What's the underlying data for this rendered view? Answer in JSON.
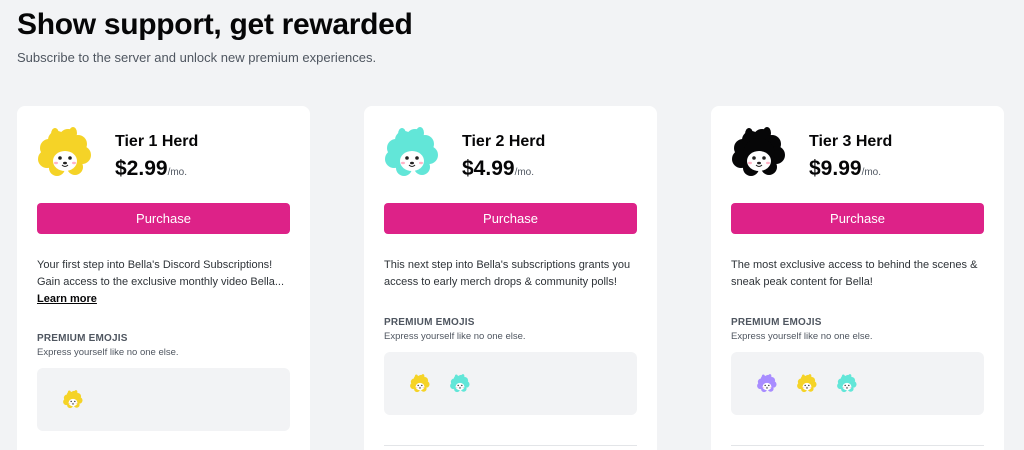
{
  "header": {
    "title": "Show support, get rewarded",
    "subtitle": "Subscribe to the server and unlock new premium experiences."
  },
  "tiers": [
    {
      "name": "Tier 1 Herd",
      "price": "$2.99",
      "period": "/mo.",
      "icon": "yellow-alpaca-icon",
      "purchase_label": "Purchase",
      "description": "Your first step into Bella's Discord Subscriptions! Gain access to the exclusive monthly video Bella...",
      "learn_more": "Learn more",
      "emoji_heading": "PREMIUM EMOJIS",
      "emoji_sub": "Express yourself like no one else.",
      "emojis": [
        "yellow-alpaca-emoji"
      ]
    },
    {
      "name": "Tier 2 Herd",
      "price": "$4.99",
      "period": "/mo.",
      "icon": "teal-alpaca-icon",
      "purchase_label": "Purchase",
      "description": "This next step into Bella's subscriptions grants you access to early merch drops & community polls!",
      "emoji_heading": "PREMIUM EMOJIS",
      "emoji_sub": "Express yourself like no one else.",
      "emojis": [
        "yellow-alpaca-emoji",
        "teal-alpaca-emoji"
      ]
    },
    {
      "name": "Tier 3 Herd",
      "price": "$9.99",
      "period": "/mo.",
      "icon": "rainbow-alpaca-icon",
      "purchase_label": "Purchase",
      "description": "The most exclusive access to behind the scenes & sneak peak content for Bella!",
      "emoji_heading": "PREMIUM EMOJIS",
      "emoji_sub": "Express yourself like no one else.",
      "emojis": [
        "rainbow-alpaca-emoji",
        "yellow-alpaca-emoji",
        "teal-alpaca-emoji"
      ]
    }
  ],
  "colors": {
    "accent": "#dd2288",
    "background": "#f2f3f5",
    "card": "#ffffff",
    "alpaca_yellow": "#f5d327",
    "alpaca_teal": "#62e6d8"
  }
}
